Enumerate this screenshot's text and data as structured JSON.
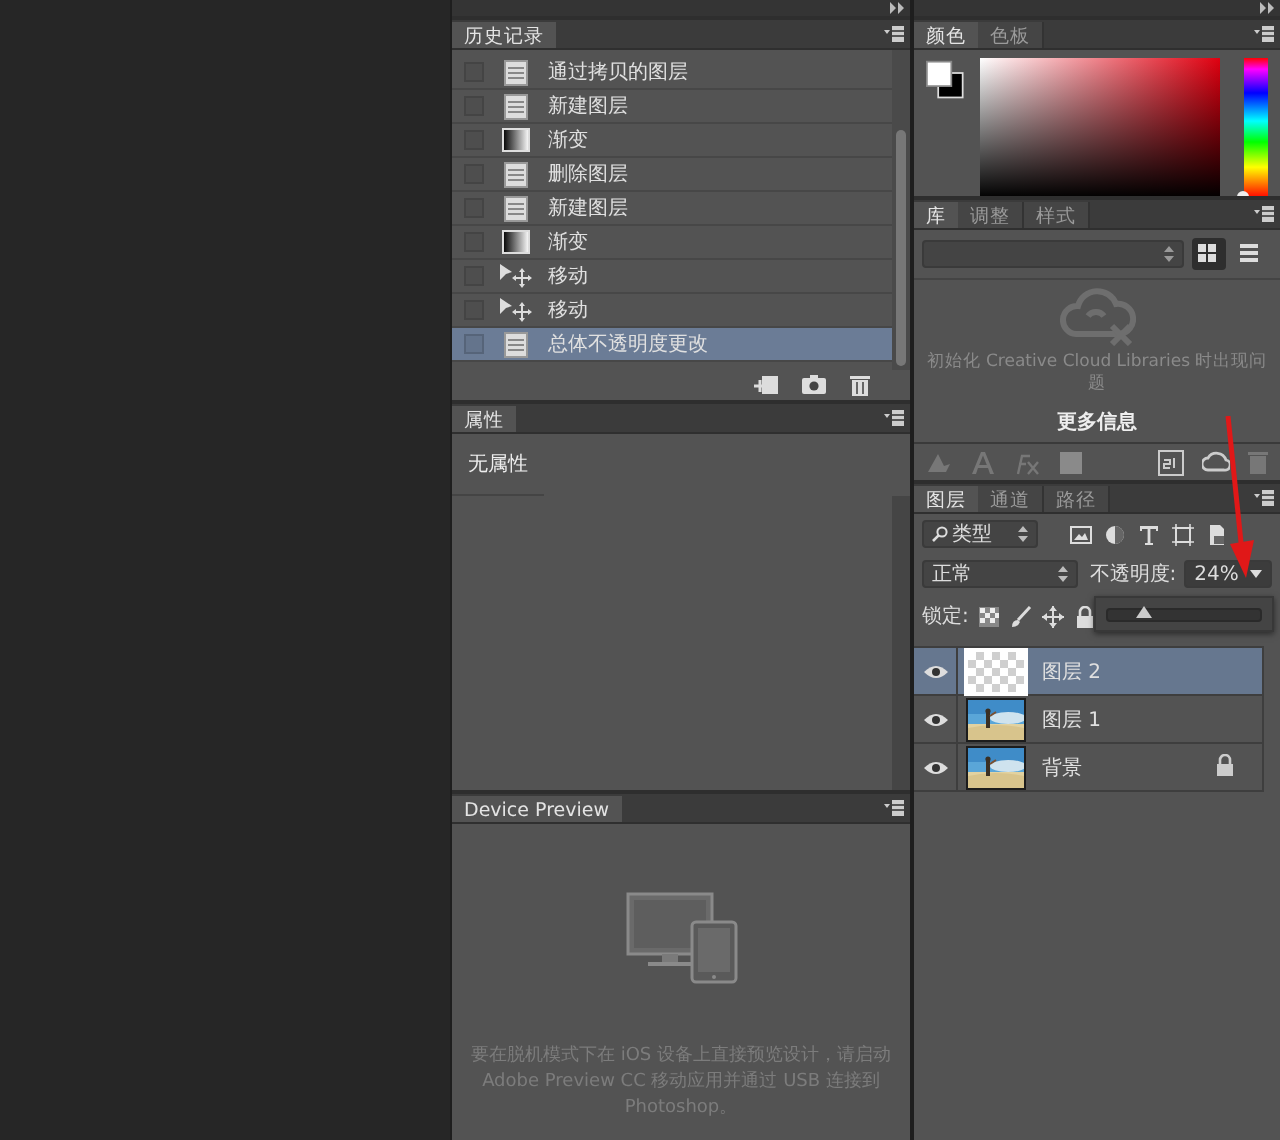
{
  "history_panel": {
    "tabs": [
      {
        "label": "历史记录",
        "selected": true
      }
    ],
    "items": [
      {
        "label": "通过拷贝的图层",
        "kind": "document",
        "selected": false
      },
      {
        "label": "新建图层",
        "kind": "document",
        "selected": false
      },
      {
        "label": "渐变",
        "kind": "gradient",
        "selected": false
      },
      {
        "label": "删除图层",
        "kind": "document",
        "selected": false
      },
      {
        "label": "新建图层",
        "kind": "document",
        "selected": false
      },
      {
        "label": "渐变",
        "kind": "gradient",
        "selected": false
      },
      {
        "label": "移动",
        "kind": "move",
        "selected": false
      },
      {
        "label": "移动",
        "kind": "move",
        "selected": false
      },
      {
        "label": "总体不透明度更改",
        "kind": "document",
        "selected": true
      }
    ]
  },
  "properties_panel": {
    "tabs": [
      {
        "label": "属性",
        "selected": true
      }
    ],
    "message": "无属性"
  },
  "device_preview_panel": {
    "tabs": [
      {
        "label": "Device Preview",
        "selected": true
      }
    ],
    "message": "要在脱机模式下在 iOS 设备上直接预览设计，请启动 Adobe Preview CC 移动应用并通过 USB 连接到 Photoshop。"
  },
  "color_panel": {
    "tabs": [
      {
        "label": "颜色",
        "selected": true
      },
      {
        "label": "色板",
        "selected": false
      }
    ],
    "hue_slider": {
      "level": 0
    }
  },
  "library_panel": {
    "tabs": [
      {
        "label": "库",
        "selected": true
      },
      {
        "label": "调整",
        "selected": false
      },
      {
        "label": "样式",
        "selected": false
      }
    ],
    "view_modes": [
      {
        "kind": "grid",
        "selected": true
      },
      {
        "kind": "list",
        "selected": false
      }
    ],
    "message": "初始化 Creative Cloud Libraries 时出现问题",
    "link": "更多信息"
  },
  "layers_panel": {
    "tabs": [
      {
        "label": "图层",
        "selected": true
      },
      {
        "label": "通道",
        "selected": false
      },
      {
        "label": "路径",
        "selected": false
      }
    ],
    "filter": "类型",
    "blend_mode": "正常",
    "opacity_label": "不透明度:",
    "opacity": "24%",
    "opacity_slider": {
      "level": 0.24
    },
    "lock_label": "锁定:",
    "layers": [
      {
        "name": "图层 2",
        "kind": "transparent",
        "visible": true,
        "selected": true,
        "locked": false
      },
      {
        "name": "图层 1",
        "visible": true,
        "selected": false,
        "locked": false
      },
      {
        "name": "背景",
        "visible": true,
        "selected": false,
        "locked": true
      }
    ]
  }
}
